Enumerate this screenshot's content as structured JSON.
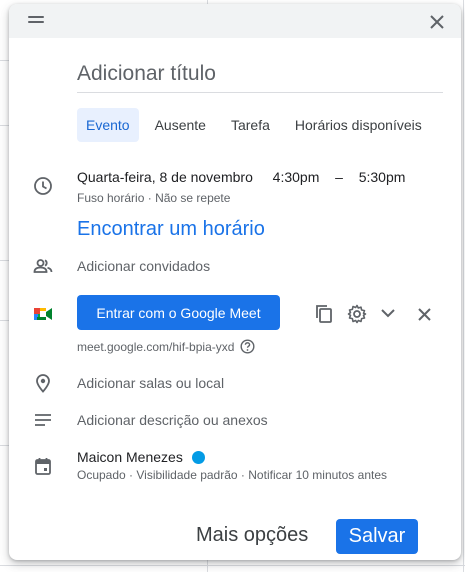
{
  "dialog": {
    "title_placeholder": "Adicionar título",
    "tabs": [
      {
        "label": "Evento",
        "active": true
      },
      {
        "label": "Ausente",
        "active": false
      },
      {
        "label": "Tarefa",
        "active": false
      },
      {
        "label": "Horários disponíveis",
        "active": false
      }
    ],
    "datetime": {
      "date": "Quarta-feira, 8 de novembro",
      "start": "4:30pm",
      "separator": "–",
      "end": "5:30pm",
      "timezone": "Fuso horário",
      "repeat": "Não se repete"
    },
    "find_time": "Encontrar um horário",
    "guests_placeholder": "Adicionar convidados",
    "meet": {
      "button_label": "Entrar com o Google Meet",
      "link": "meet.google.com/hif-bpia-yxd"
    },
    "location_placeholder": "Adicionar salas ou local",
    "description_placeholder": "Adicionar descrição ou anexos",
    "owner": {
      "name": "Maicon Menezes",
      "color": "#039be5",
      "status": "Ocupado",
      "visibility": "Visibilidade padrão",
      "notification": "Notificar 10 minutos antes"
    },
    "footer": {
      "more_options": "Mais opções",
      "save": "Salvar"
    }
  },
  "icons": [
    "drag-handle-icon",
    "close-icon",
    "clock-icon",
    "people-icon",
    "google-meet-icon",
    "copy-icon",
    "gear-icon",
    "chevron-down-icon",
    "remove-icon",
    "help-icon",
    "location-pin-icon",
    "description-icon",
    "calendar-icon"
  ],
  "colors": {
    "accent": "#1a73e8",
    "tab_active_bg": "#e8f0fe",
    "header_bg": "#f1f3f4"
  }
}
